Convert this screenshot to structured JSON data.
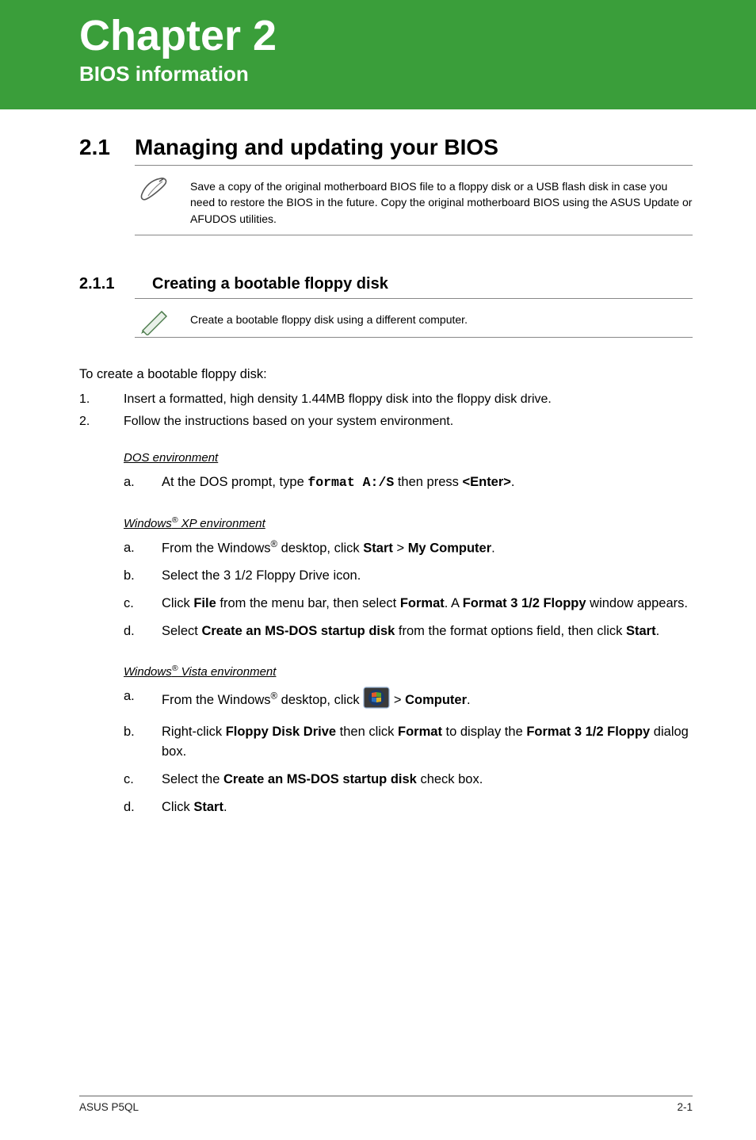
{
  "header": {
    "chapter": "Chapter 2",
    "subtitle": "BIOS information"
  },
  "section1": {
    "num": "2.1",
    "title": "Managing and updating your BIOS",
    "callout": "Save a copy of the original motherboard BIOS file to a floppy disk or a USB flash disk in case you need to restore the BIOS in the future. Copy the original motherboard BIOS using the ASUS Update or AFUDOS utilities."
  },
  "section11": {
    "num": "2.1.1",
    "title": "Creating a bootable floppy disk",
    "callout": "Create a bootable floppy disk using a different computer."
  },
  "body": {
    "intro": "To create a bootable floppy disk:",
    "steps": {
      "s1": {
        "n": "1.",
        "t": "Insert a formatted, high density 1.44MB floppy disk into the floppy disk drive."
      },
      "s2": {
        "n": "2.",
        "t": "Follow the instructions based on your system environment."
      }
    },
    "dos": {
      "head": "DOS environment",
      "a_pre": "At the DOS prompt, type ",
      "a_cmd": "format A:/S",
      "a_mid": " then press ",
      "a_key": "<Enter>",
      "a_post": "."
    },
    "xp": {
      "head_pre": "Windows",
      "head_sup": "®",
      "head_post": " XP environment",
      "a_pre": "From the Windows",
      "a_sup": "®",
      "a_mid": " desktop, click ",
      "a_b1": "Start",
      "a_gt": " > ",
      "a_b2": "My Computer",
      "a_post": ".",
      "b": "Select the 3 1/2 Floppy Drive icon.",
      "c_pre": "Click ",
      "c_b1": "File",
      "c_mid1": " from the menu bar, then select ",
      "c_b2": "Format",
      "c_mid2": ". A ",
      "c_b3": "Format 3 1/2 Floppy",
      "c_post": " window appears.",
      "d_pre": "Select ",
      "d_b1": "Create an MS-DOS startup disk",
      "d_mid": " from the format options field, then click ",
      "d_b2": "Start",
      "d_post": "."
    },
    "vista": {
      "head_pre": "Windows",
      "head_sup": "®",
      "head_post": " Vista environment",
      "a_pre": "From the Windows",
      "a_sup": "®",
      "a_mid": " desktop, click ",
      "a_gt": " > ",
      "a_b2": "Computer",
      "a_post": ".",
      "b_pre": "Right-click ",
      "b_b1": "Floppy Disk Drive",
      "b_mid": " then click ",
      "b_b2": "Format",
      "b_mid2": " to display the ",
      "b_b3": "Format 3 1/2 Floppy",
      "b_post": " dialog box.",
      "c_pre": "Select the ",
      "c_b1": "Create an MS-DOS startup disk",
      "c_post": " check box.",
      "d_pre": "Click ",
      "d_b1": "Start",
      "d_post": "."
    },
    "letters": {
      "a": "a.",
      "b": "b.",
      "c": "c.",
      "d": "d."
    }
  },
  "footer": {
    "left": "ASUS P5QL",
    "right": "2-1"
  }
}
